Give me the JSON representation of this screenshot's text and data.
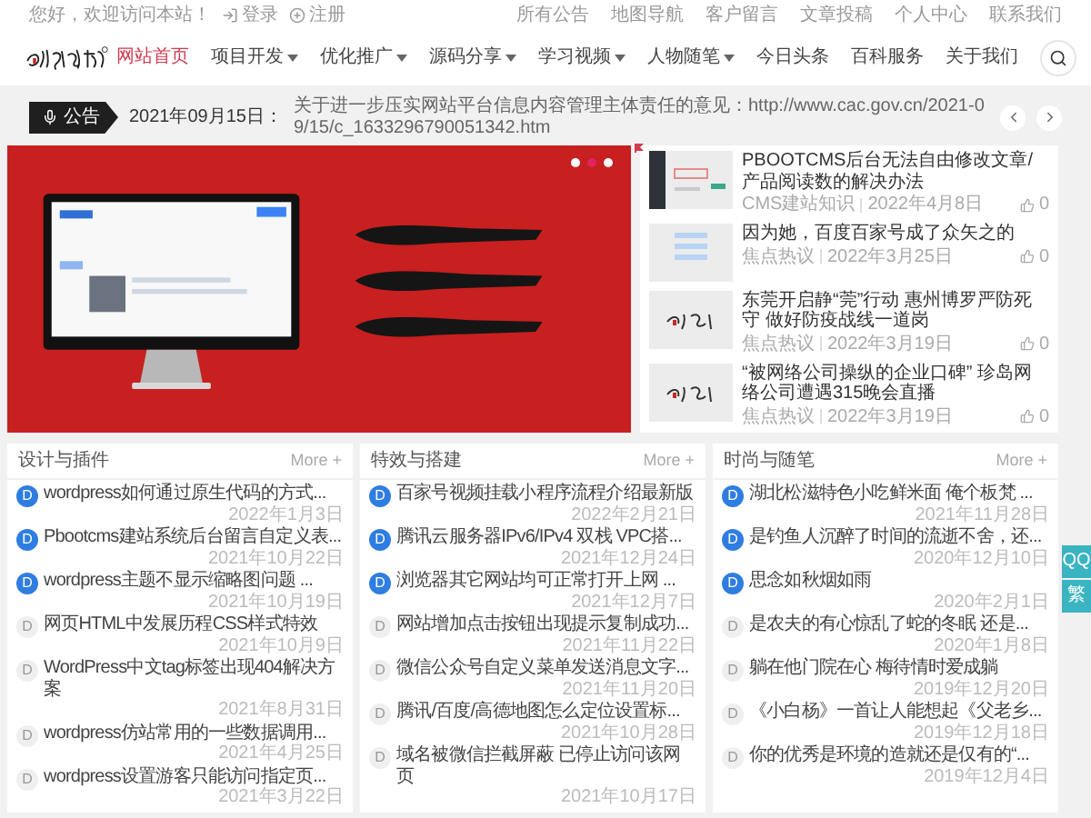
{
  "top_bar": {
    "greeting": "您好，欢迎访问本站！",
    "login": "登录",
    "register": "注册",
    "links": [
      "所有公告",
      "地图导航",
      "客户留言",
      "文章投稿",
      "个人中心",
      "联系我们"
    ]
  },
  "nav": {
    "items": [
      {
        "label": "网站首页",
        "selected": true,
        "dropdown": false
      },
      {
        "label": "项目开发",
        "selected": false,
        "dropdown": true
      },
      {
        "label": "优化推广",
        "selected": false,
        "dropdown": true
      },
      {
        "label": "源码分享",
        "selected": false,
        "dropdown": true
      },
      {
        "label": "学习视频",
        "selected": false,
        "dropdown": true
      },
      {
        "label": "人物随笔",
        "selected": false,
        "dropdown": true
      },
      {
        "label": "今日头条",
        "selected": false,
        "dropdown": false
      },
      {
        "label": "百科服务",
        "selected": false,
        "dropdown": false
      },
      {
        "label": "关于我们",
        "selected": false,
        "dropdown": false
      }
    ]
  },
  "notice": {
    "badge": "公告",
    "date": "2021年09月15日：",
    "text": "关于进一步压实网站平台信息内容管理主体责任的意见：http://www.cac.gov.cn/2021-09/15/c_1633296790051342.htm"
  },
  "banner": {
    "kind": "picture",
    "dots": [
      {
        "selected": false
      },
      {
        "selected": true
      },
      {
        "selected": false
      }
    ]
  },
  "featured": [
    {
      "title": "PBOOTCMS后台无法自由修改文章/产品阅读数的解决办法",
      "category": "CMS建站知识",
      "date": "2022年4月8日",
      "likes": "0"
    },
    {
      "title": "因为她，百度百家号成了众矢之的",
      "category": "焦点热议",
      "date": "2022年3月25日",
      "likes": "0"
    },
    {
      "title": "东莞开启静“莞”行动 惠州博罗严防死守 做好防疫战线一道岗",
      "category": "焦点热议",
      "date": "2022年3月19日",
      "likes": "0"
    },
    {
      "title": "“被网络公司操纵的企业口碑” 珍岛网络公司遭遇315晚会直播",
      "category": "焦点热议",
      "date": "2022年3月19日",
      "likes": "0"
    }
  ],
  "sections": [
    {
      "title": "设计与插件",
      "more": "More +",
      "items": [
        {
          "badge": "D",
          "title": "wordpress如何通过原生代码的方式...",
          "date": "2022年1月3日",
          "highlighted": true
        },
        {
          "badge": "D",
          "title": "Pbootcms建站系统后台留言自定义表...",
          "date": "2021年10月22日",
          "highlighted": true
        },
        {
          "badge": "D",
          "title": "wordpress主题不显示缩略图问题 ...",
          "date": "2021年10月19日",
          "highlighted": true
        },
        {
          "badge": "D",
          "title": "网页HTML中发展历程CSS样式特效",
          "date": "2021年10月9日",
          "highlighted": false
        },
        {
          "badge": "D",
          "title": "WordPress中文tag标签出现404解决方案",
          "date": "2021年8月31日",
          "highlighted": false
        },
        {
          "badge": "D",
          "title": "wordpress仿站常用的一些数据调用...",
          "date": "2021年4月25日",
          "highlighted": false
        },
        {
          "badge": "D",
          "title": "wordpress设置游客只能访问指定页...",
          "date": "2021年3月22日",
          "highlighted": false
        }
      ]
    },
    {
      "title": "特效与搭建",
      "more": "More +",
      "items": [
        {
          "badge": "D",
          "title": "百家号视频挂载小程序流程介绍最新版",
          "date": "2022年2月21日",
          "highlighted": true
        },
        {
          "badge": "D",
          "title": "腾讯云服务器IPv6/IPv4 双栈 VPC搭...",
          "date": "2021年12月24日",
          "highlighted": true
        },
        {
          "badge": "D",
          "title": "浏览器其它网站均可正常打开上网 ...",
          "date": "2021年12月7日",
          "highlighted": true
        },
        {
          "badge": "D",
          "title": "网站增加点击按钮出现提示复制成功...",
          "date": "2021年11月22日",
          "highlighted": false
        },
        {
          "badge": "D",
          "title": "微信公众号自定义菜单发送消息文字...",
          "date": "2021年11月20日",
          "highlighted": false
        },
        {
          "badge": "D",
          "title": "腾讯/百度/高德地图怎么定位设置标...",
          "date": "2021年10月28日",
          "highlighted": false
        },
        {
          "badge": "D",
          "title": "域名被微信拦截屏蔽 已停止访问该网页",
          "date": "2021年10月17日",
          "highlighted": false
        }
      ]
    },
    {
      "title": "时尚与随笔",
      "more": "More +",
      "items": [
        {
          "badge": "D",
          "title": "湖北松滋特色小吃鲜米面 俺个板梵 ...",
          "date": "2021年11月28日",
          "highlighted": true
        },
        {
          "badge": "D",
          "title": "是钓鱼人沉醉了时间的流逝不舍，还...",
          "date": "2020年12月10日",
          "highlighted": true
        },
        {
          "badge": "D",
          "title": "思念如秋烟如雨",
          "date": "2020年2月1日",
          "highlighted": true
        },
        {
          "badge": "D",
          "title": "是农夫的有心惊乱了蛇的冬眠 还是...",
          "date": "2020年1月8日",
          "highlighted": false
        },
        {
          "badge": "D",
          "title": "躺在他门院在心 梅待情时爱成躺",
          "date": "2019年12月20日",
          "highlighted": false
        },
        {
          "badge": "D",
          "title": "《小白杨》一首让人能想起《父老乡...",
          "date": "2019年12月18日",
          "highlighted": false
        },
        {
          "badge": "D",
          "title": "你的优秀是环境的造就还是仅有的“...",
          "date": "2019年12月4日",
          "highlighted": false
        }
      ]
    }
  ],
  "float_buttons": [
    "QQ",
    "繁"
  ]
}
